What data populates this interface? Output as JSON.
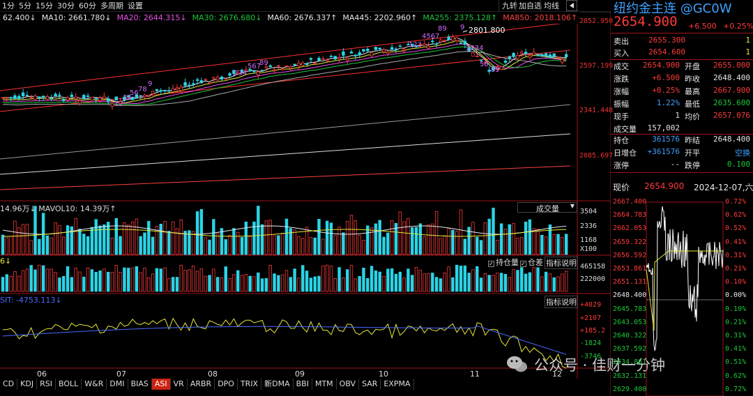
{
  "toolbar": {
    "periods": [
      "1分",
      "5分",
      "15分",
      "30分",
      "60分",
      "多周期",
      "设置"
    ],
    "ma_values": [
      {
        "label": "62.400↓",
        "color": "#e8e8e8"
      },
      {
        "label": "MA10: 2661.780↓",
        "color": "#e8e8e8"
      },
      {
        "label": "MA20: 2644.315↓",
        "color": "#e84fe8"
      },
      {
        "label": "MA30: 2676.680↓",
        "color": "#1cc839"
      },
      {
        "label": "MA60: 2676.337↑",
        "color": "#e8e8e8"
      },
      {
        "label": "MA445: 2202.960↑",
        "color": "#e8e8e8"
      },
      {
        "label": "MA255: 2375.128↑",
        "color": "#1cc839"
      },
      {
        "label": "MA850: 2018.106↑",
        "color": "#ff4040"
      }
    ],
    "right_buttons": [
      "九转",
      "加自选",
      "均线"
    ],
    "collapse_icon": "triangle-left-icon"
  },
  "price_axis": {
    "labels": [
      "2852.950",
      "2597.199",
      "2341.448",
      "2085.697"
    ]
  },
  "annotations": {
    "high": "2801.800",
    "nine_count_labels": [
      "12",
      "34",
      "56",
      "78",
      "9",
      "234",
      "567",
      "89",
      "123",
      "4567",
      "89",
      "1234",
      "56",
      "89",
      "9"
    ]
  },
  "volume_panel": {
    "header": "14.96万↓   MAVOL10: 14.39万↑",
    "dropdown": "成交量",
    "axis": [
      "3504",
      "2336",
      "1168",
      "X100"
    ]
  },
  "oi_panel": {
    "header": "6↓",
    "options": [
      "持仓量",
      "仓差"
    ],
    "explain": "指标说明",
    "axis": [
      "465158",
      "222000"
    ]
  },
  "asi_panel": {
    "header": "SIT: -4753.113↓",
    "explain": "指标说明",
    "axis": [
      "+4029",
      "+2107",
      "+185.2",
      "-1824",
      "-3746"
    ]
  },
  "months": [
    "06",
    "07",
    "08",
    "09",
    "10",
    "11",
    "12"
  ],
  "bottom_tabs": [
    "CD",
    "KDJ",
    "RSI",
    "BOLL",
    "W&R",
    "DMI",
    "BIAS",
    "ASI",
    "VR",
    "ARBR",
    "DPO",
    "TRIX",
    "新DMA",
    "BBI",
    "MTM",
    "OBV",
    "SAR",
    "EXPMA"
  ],
  "active_tab": "ASI",
  "watermark": "公众号 · 佳财一分钟",
  "quote": {
    "title": "纽约金主连 @GC0W",
    "price": "2654.900",
    "change": "+6.500",
    "change_pct": "+0.25%",
    "sell_label": "卖出",
    "sell_price": "2655.300",
    "sell_qty": "1",
    "buy_label": "买入",
    "buy_price": "2654.600",
    "buy_qty": "1",
    "rows": [
      {
        "l1": "成交",
        "v1": "2654.900",
        "l2": "开盘",
        "v2": "2655.000",
        "c1": "red",
        "c2": "red"
      },
      {
        "l1": "涨跌",
        "v1": "+6.500",
        "l2": "昨收",
        "v2": "2648.400",
        "c1": "red",
        "c2": "white"
      },
      {
        "l1": "涨幅",
        "v1": "+0.25%",
        "l2": "最高",
        "v2": "2667.900",
        "c1": "red",
        "c2": "red"
      },
      {
        "l1": "振幅",
        "v1": "1.22%",
        "l2": "最低",
        "v2": "2635.600",
        "c1": "blue",
        "c2": "green"
      },
      {
        "l1": "现手",
        "v1": "1",
        "l2": "均价",
        "v2": "2657.076",
        "c1": "white",
        "c2": "red"
      },
      {
        "l1": "成交量",
        "v1": "157,002",
        "l2": "",
        "v2": "",
        "c1": "white",
        "c2": "white"
      }
    ],
    "rows2": [
      {
        "l1": "持仓",
        "v1": "361576",
        "l2": "昨结",
        "v2": "2648.400",
        "c1": "blue",
        "c2": "white"
      },
      {
        "l1": "日增仓",
        "v1": "+361576",
        "l2": "开平",
        "v2": "空换",
        "c1": "blue",
        "c2": "blue"
      },
      {
        "l1": "涨停",
        "v1": "--",
        "l2": "跌停",
        "v2": "0.100",
        "c1": "white",
        "c2": "green"
      }
    ],
    "now_label": "现价",
    "now_price": "2654.900",
    "now_date": "2024-12-07,六"
  },
  "intraday": {
    "left_axis": [
      "2667.400",
      "2664.783",
      "2662.053",
      "2659.322",
      "2656.592",
      "2653.861",
      "2651.131",
      "2648.400",
      "2645.783",
      "2643.053",
      "2640.322",
      "2637.592",
      "2634.861",
      "2632.131",
      "2629.400"
    ],
    "right_axis": [
      "0.72%",
      "0.62%",
      "0.52%",
      "0.41%",
      "0.31%",
      "0.21%",
      "0.10%",
      "0.00%",
      "0.10%",
      "0.21%",
      "0.31%",
      "0.41%",
      "0.51%",
      "0.62%",
      "0.72%"
    ]
  }
}
